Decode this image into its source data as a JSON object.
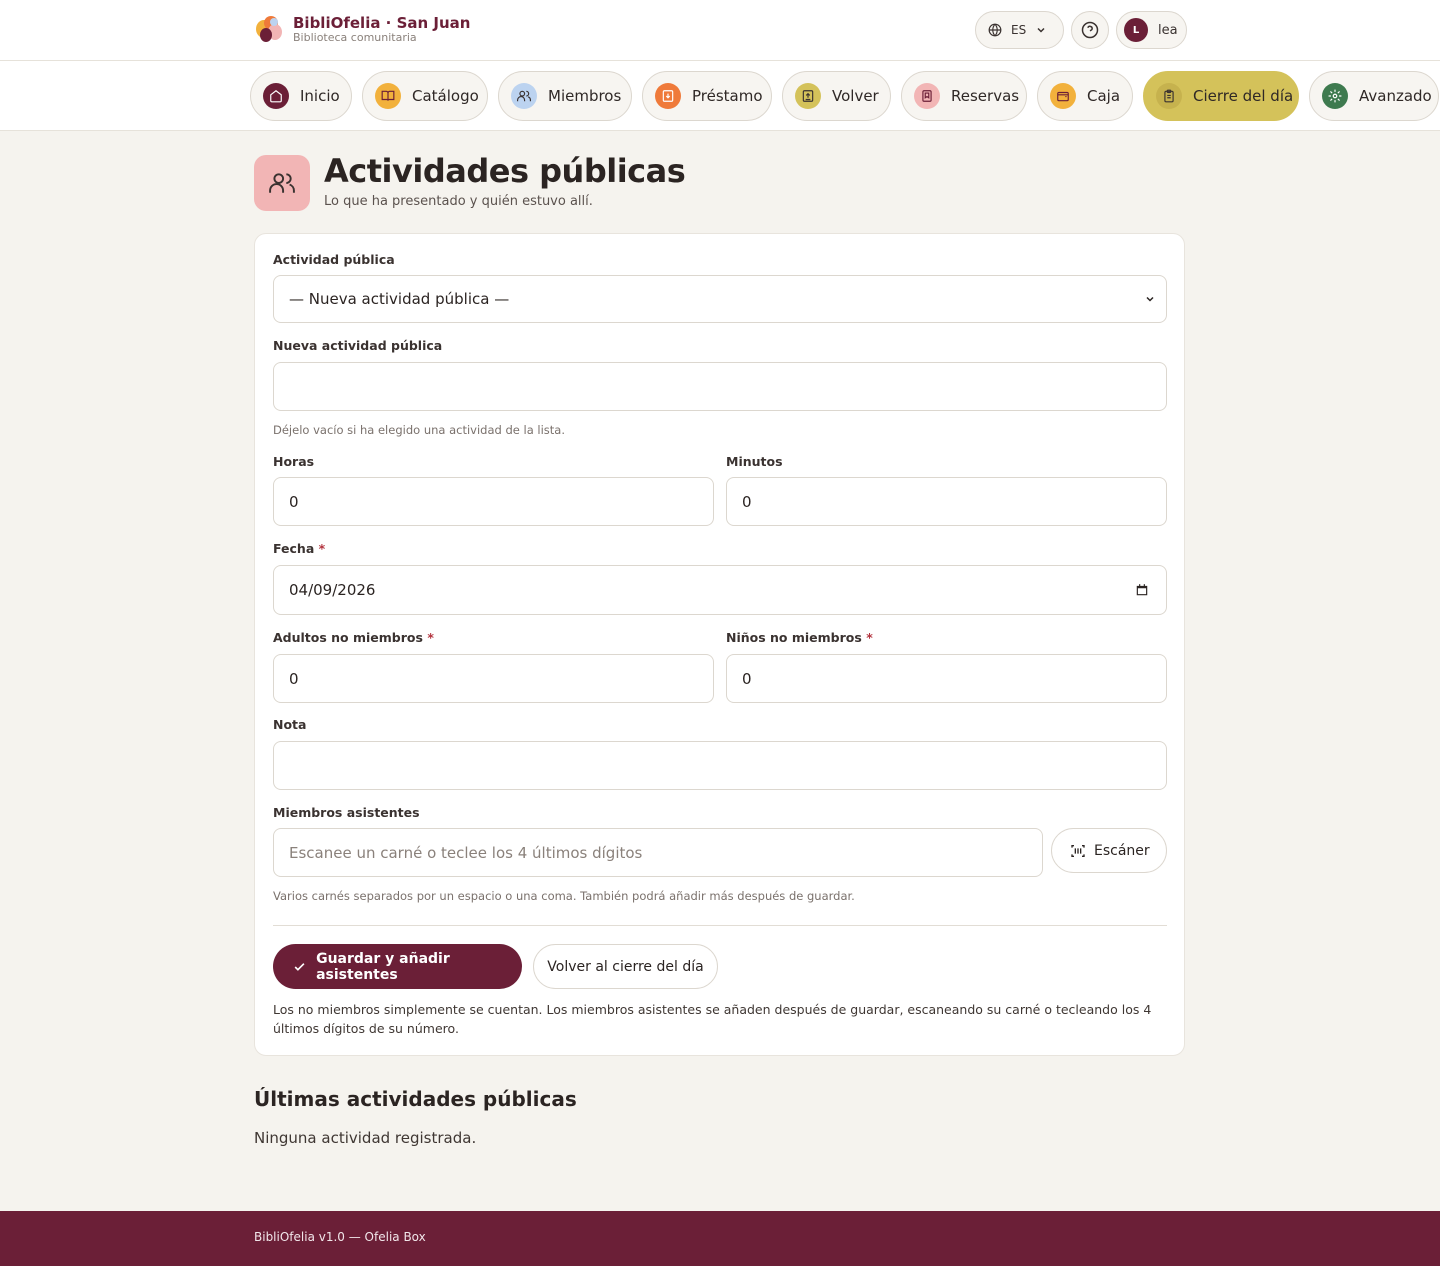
{
  "brand": {
    "name": "BibliOfelia · San Juan",
    "subtitle": "Biblioteca comunitaria"
  },
  "topbar": {
    "language": "ES",
    "user_initial": "L",
    "user_name": "lea"
  },
  "nav": {
    "items": [
      {
        "label": "Inicio",
        "icon": "home-icon",
        "color": "#6b1f37"
      },
      {
        "label": "Catálogo",
        "icon": "book-icon",
        "color": "#f2b13c"
      },
      {
        "label": "Miembros",
        "icon": "users-icon",
        "color": "#bcd3f0"
      },
      {
        "label": "Préstamo",
        "icon": "loan-icon",
        "color": "#ef7a3a"
      },
      {
        "label": "Volver",
        "icon": "return-icon",
        "color": "#d4c25a"
      },
      {
        "label": "Reservas",
        "icon": "bookmark-icon",
        "color": "#f2b5b5"
      },
      {
        "label": "Caja",
        "icon": "wallet-icon",
        "color": "#f2b13c"
      },
      {
        "label": "Cierre del día",
        "icon": "clipboard-icon",
        "color": "#c6b24e",
        "active": true
      },
      {
        "label": "Avanzado",
        "icon": "gear-icon",
        "color": "#3e7a4f"
      }
    ]
  },
  "page": {
    "title": "Actividades públicas",
    "subtitle": "Lo que ha presentado y quién estuvo allí."
  },
  "form": {
    "activity_label": "Actividad pública",
    "activity_selected": "— Nueva actividad pública —",
    "new_activity_label": "Nueva actividad pública",
    "new_activity_value": "",
    "new_activity_hint": "Déjelo vacío si ha elegido una actividad de la lista.",
    "hours_label": "Horas",
    "hours_value": "0",
    "minutes_label": "Minutos",
    "minutes_value": "0",
    "date_label": "Fecha",
    "date_value": "04/09/2026",
    "adults_label": "Adultos no miembros",
    "adults_value": "0",
    "children_label": "Niños no miembros",
    "children_value": "0",
    "required_mark": "*",
    "note_label": "Nota",
    "note_value": "",
    "members_label": "Miembros asistentes",
    "members_placeholder": "Escanee un carné o teclee los 4 últimos dígitos",
    "scanner_label": "Escáner",
    "members_hint": "Varios carnés separados por un espacio o una coma. También podrá añadir más después de guardar.",
    "save_label": "Guardar y añadir asistentes",
    "back_label": "Volver al cierre del día",
    "footer_note": "Los no miembros simplemente se cuentan. Los miembros asistentes se añaden después de guardar, escaneando su carné o tecleando los 4 últimos dígitos de su número."
  },
  "recent": {
    "title": "Últimas actividades públicas",
    "empty": "Ninguna actividad registrada."
  },
  "footer": {
    "text": "BibliOfelia v1.0 — Ofelia Box"
  },
  "colors": {
    "primary": "#6b1f37",
    "active_nav": "#d4c25a",
    "page_icon_bg": "#f2b5b5",
    "background": "#f5f3ee"
  }
}
